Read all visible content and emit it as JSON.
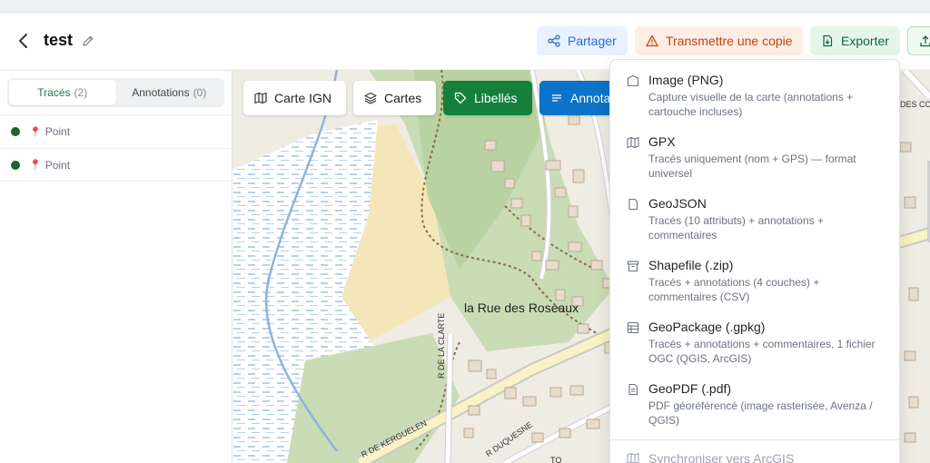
{
  "header": {
    "title": "test",
    "share_label": "Partager",
    "transmit_label": "Transmettre une copie",
    "export_label": "Exporter"
  },
  "sidebar": {
    "tabs": [
      {
        "label": "Tracés",
        "count": "(2)"
      },
      {
        "label": "Annotations",
        "count": "(0)"
      }
    ],
    "items": [
      {
        "label": "Point"
      },
      {
        "label": "Point"
      }
    ]
  },
  "map": {
    "buttons": {
      "ign": "Carte IGN",
      "cartes": "Cartes",
      "libelles": "Libellés",
      "annotations": "Annota"
    },
    "place_label": "la Rue des Roseaux",
    "streets": {
      "clarte": "R DE LA CLARTE",
      "kerguelen": "R DE KERGUELEN",
      "duquesne": "R DUQUESNE",
      "des_co": "DES CO",
      "to": "TO"
    }
  },
  "export_menu": {
    "items": [
      {
        "title": "Image (PNG)",
        "desc": "Capture visuelle de la carte (annotations + cartouche incluses)"
      },
      {
        "title": "GPX",
        "desc": "Tracés uniquement (nom + GPS) — format universel"
      },
      {
        "title": "GeoJSON",
        "desc": "Tracés (10 attributs) + annotations + commentaires"
      },
      {
        "title": "Shapefile (.zip)",
        "desc": "Tracés + annotations (4 couches) + commentaires (CSV)"
      },
      {
        "title": "GeoPackage (.gpkg)",
        "desc": "Tracés + annotations + commentaires, 1 fichier OGC (QGIS, ArcGIS)"
      },
      {
        "title": "GeoPDF (.pdf)",
        "desc": "PDF géoréférencé (image rasterisée, Avenza / QGIS)"
      }
    ],
    "sync_label": "Synchroniser vers ArcGIS"
  },
  "colors": {
    "primary_green": "#15803d",
    "primary_blue": "#0b74c8",
    "share_blue": "#2b6cd1",
    "transmit_orange": "#c2410c"
  }
}
